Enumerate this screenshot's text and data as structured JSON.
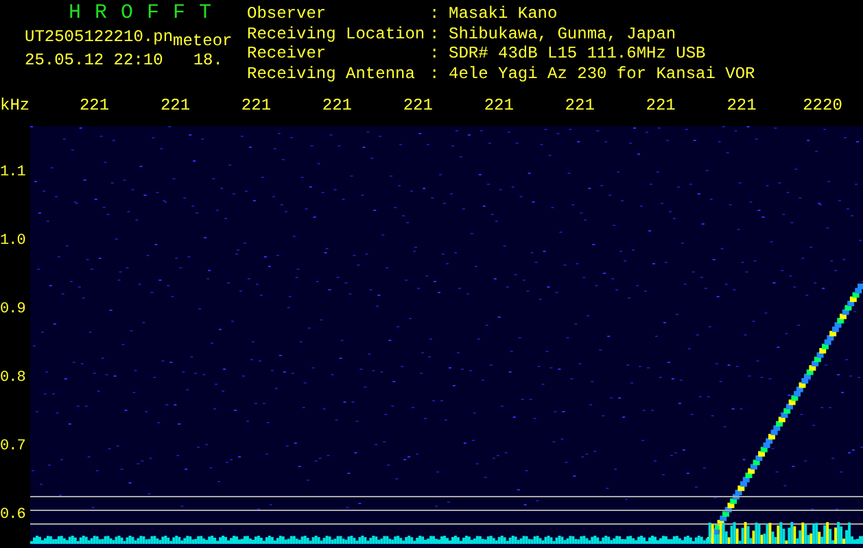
{
  "header": {
    "title": "HROFFT",
    "file_name": "UT2505122210.pn",
    "mode": "meteor",
    "date_time": "25.05.12 22:10",
    "number": "18."
  },
  "info": [
    {
      "label": "Observer",
      "separator": ":",
      "value": "Masaki Kano"
    },
    {
      "label": "Receiving Location",
      "separator": ":",
      "value": "Shibukawa, Gunma, Japan"
    },
    {
      "label": "Receiver",
      "separator": ":",
      "value": "SDR# 43dB L15 111.6MHz USB"
    },
    {
      "label": "Receiving Antenna",
      "separator": ":",
      "value": "4ele Yagi Az 230 for Kansai VOR"
    }
  ],
  "x_axis": {
    "unit": "kHz",
    "labels": [
      "221",
      "221",
      "221",
      "221",
      "221",
      "221",
      "221",
      "221",
      "221",
      "2220"
    ]
  },
  "y_axis": {
    "labels": [
      "1.1",
      "1.0",
      "0.9",
      "0.8",
      "0.7",
      "0.6"
    ]
  }
}
